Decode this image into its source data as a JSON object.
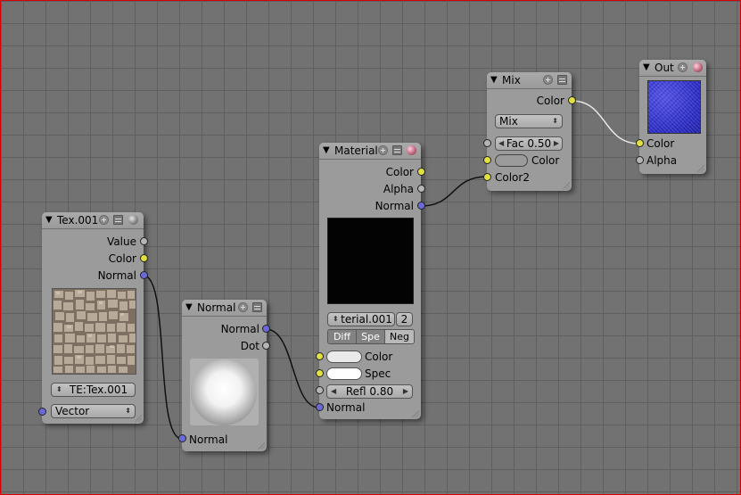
{
  "nodes": {
    "tex": {
      "title": "Tex.001",
      "outputs": [
        "Value",
        "Color",
        "Normal"
      ],
      "texture_field": "TE:Tex.001",
      "mapping_select": "Vector"
    },
    "normal": {
      "title": "Normal",
      "outputs": [
        "Normal",
        "Dot"
      ],
      "input": "Normal"
    },
    "material": {
      "title": "Material",
      "outputs": [
        "Color",
        "Alpha",
        "Normal"
      ],
      "material_field": "terial.001",
      "users": "2",
      "toggles": [
        "Diff",
        "Spe",
        "Neg"
      ],
      "inputs": [
        "Color",
        "Spec",
        "Normal"
      ],
      "refl_field": "Refl 0.80"
    },
    "mix": {
      "title": "Mix",
      "output": "Color",
      "blend_mode": "Mix",
      "fac_field": "Fac 0.50",
      "inputs": [
        "Color",
        "Color2"
      ]
    },
    "out": {
      "title": "Out",
      "inputs": [
        "Color",
        "Alpha"
      ]
    }
  },
  "colors": {
    "socket_color": "#e0e040",
    "socket_value": "#b5b5b5",
    "socket_vector": "#6a6ad8",
    "material_swatch": "#eaeaea"
  },
  "icons": [
    "triangle-collapse-icon",
    "plus-icon",
    "list-icon",
    "preview-ball-icon",
    "resize-grip-icon"
  ]
}
